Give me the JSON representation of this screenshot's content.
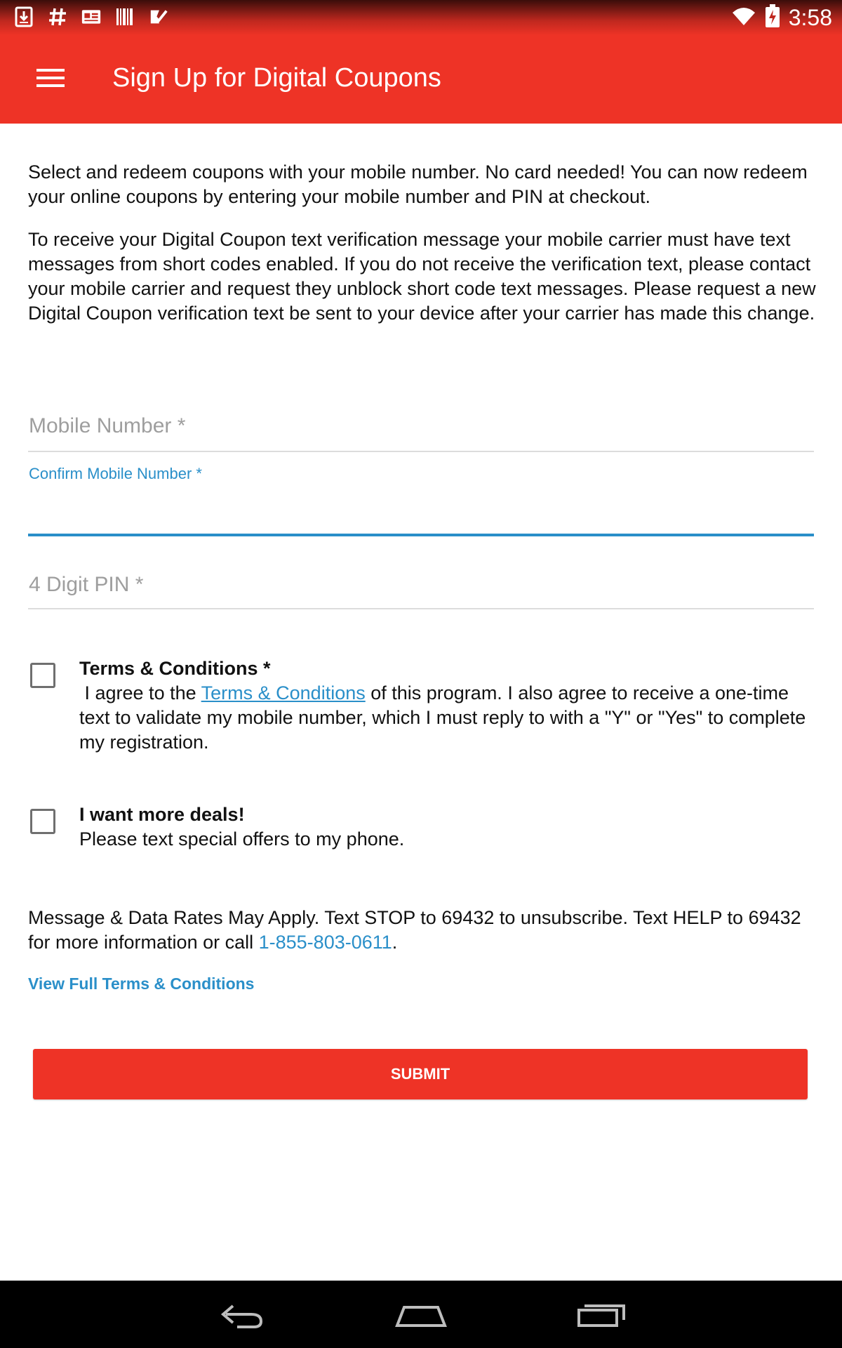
{
  "status_bar": {
    "time": "3:58",
    "icons": [
      "download-icon",
      "hash-icon",
      "news-icon",
      "barcode-icon",
      "checklist-icon",
      "wifi-icon",
      "battery-charging-icon"
    ]
  },
  "app_bar": {
    "title": "Sign Up for Digital Coupons",
    "menu_icon": "hamburger-menu-icon"
  },
  "intro": {
    "paragraph_1": "Select and redeem coupons with your mobile number. No card needed! You can now redeem your online coupons by entering your mobile number and PIN at checkout.",
    "paragraph_2": "To receive your Digital Coupon text verification message your mobile carrier must have text messages from short codes enabled. If you do not receive the verification text, please contact your mobile carrier and request they unblock short code text messages. Please request a new Digital Coupon verification text be sent to your device after your carrier has made this change."
  },
  "form": {
    "mobile_number": {
      "placeholder": "Mobile Number *",
      "value": ""
    },
    "confirm_mobile_number": {
      "label": "Confirm Mobile Number *",
      "value": ""
    },
    "pin": {
      "placeholder": "4 Digit PIN *",
      "value": ""
    }
  },
  "terms": {
    "checked": false,
    "title": "Terms & Conditions *",
    "text_before": " I agree to the ",
    "link_text": "Terms & Conditions",
    "text_after": " of this program. I also agree to receive a one-time text to validate my mobile number, which I must reply to with a \"Y\" or \"Yes\" to complete my registration."
  },
  "deals": {
    "checked": false,
    "title": "I want more deals!",
    "text": "Please text special offers to my phone."
  },
  "disclaimer": {
    "text": "Message & Data Rates May Apply. Text STOP to 69432 to unsubscribe. Text HELP to 69432 for more information or call ",
    "phone": "1-855-803-0611",
    "suffix": "."
  },
  "view_terms_label": "View Full Terms & Conditions",
  "submit_label": "SUBMIT",
  "colors": {
    "brand_red": "#ee3326",
    "link_blue": "#2a8fc9"
  }
}
